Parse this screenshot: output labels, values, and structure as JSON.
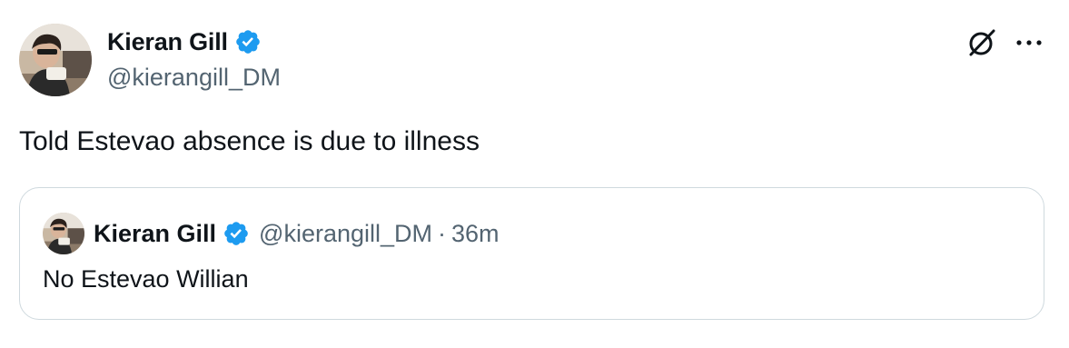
{
  "author": {
    "display_name": "Kieran Gill",
    "handle": "@kierangill_DM",
    "verified": true,
    "avatar_icon": "profile-photo"
  },
  "tweet": {
    "text": "Told Estevao absence is due to illness"
  },
  "actions": {
    "grok_icon": "grok-icon",
    "more_icon": "more-icon"
  },
  "quoted_tweet": {
    "display_name": "Kieran Gill",
    "handle": "@kierangill_DM",
    "separator": "·",
    "time": "36m",
    "text": "No Estevao Willian",
    "verified": true
  },
  "colors": {
    "verified_blue": "#1d9bf0",
    "secondary_text": "#536471",
    "border": "#cfd9de",
    "primary_text": "#0f1419"
  }
}
